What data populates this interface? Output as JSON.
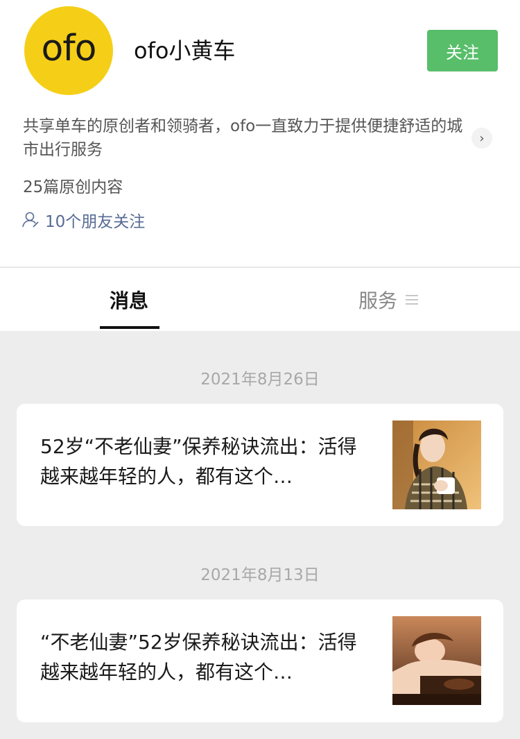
{
  "profile": {
    "logo_text": "ofo",
    "name": "ofo小黄车",
    "follow_label": "关注",
    "description": "共享单车的原创者和领骑者，ofo一直致力于提供便捷舒适的城市出行服务",
    "article_count": "25篇原创内容",
    "friends_following": "10个朋友关注",
    "brand_color": "#f5cf17",
    "follow_color": "#58be6a"
  },
  "tabs": [
    {
      "label": "消息",
      "active": true
    },
    {
      "label": "服务",
      "active": false
    }
  ],
  "messages": [
    {
      "date": "2021年8月26日",
      "title": "52岁“不老仙妻”保养秘诀流出：活得越来越年轻的人，都有这个…"
    },
    {
      "date": "2021年8月13日",
      "title": "“不老仙妻”52岁保养秘诀流出：活得越来越年轻的人，都有这个…"
    }
  ]
}
